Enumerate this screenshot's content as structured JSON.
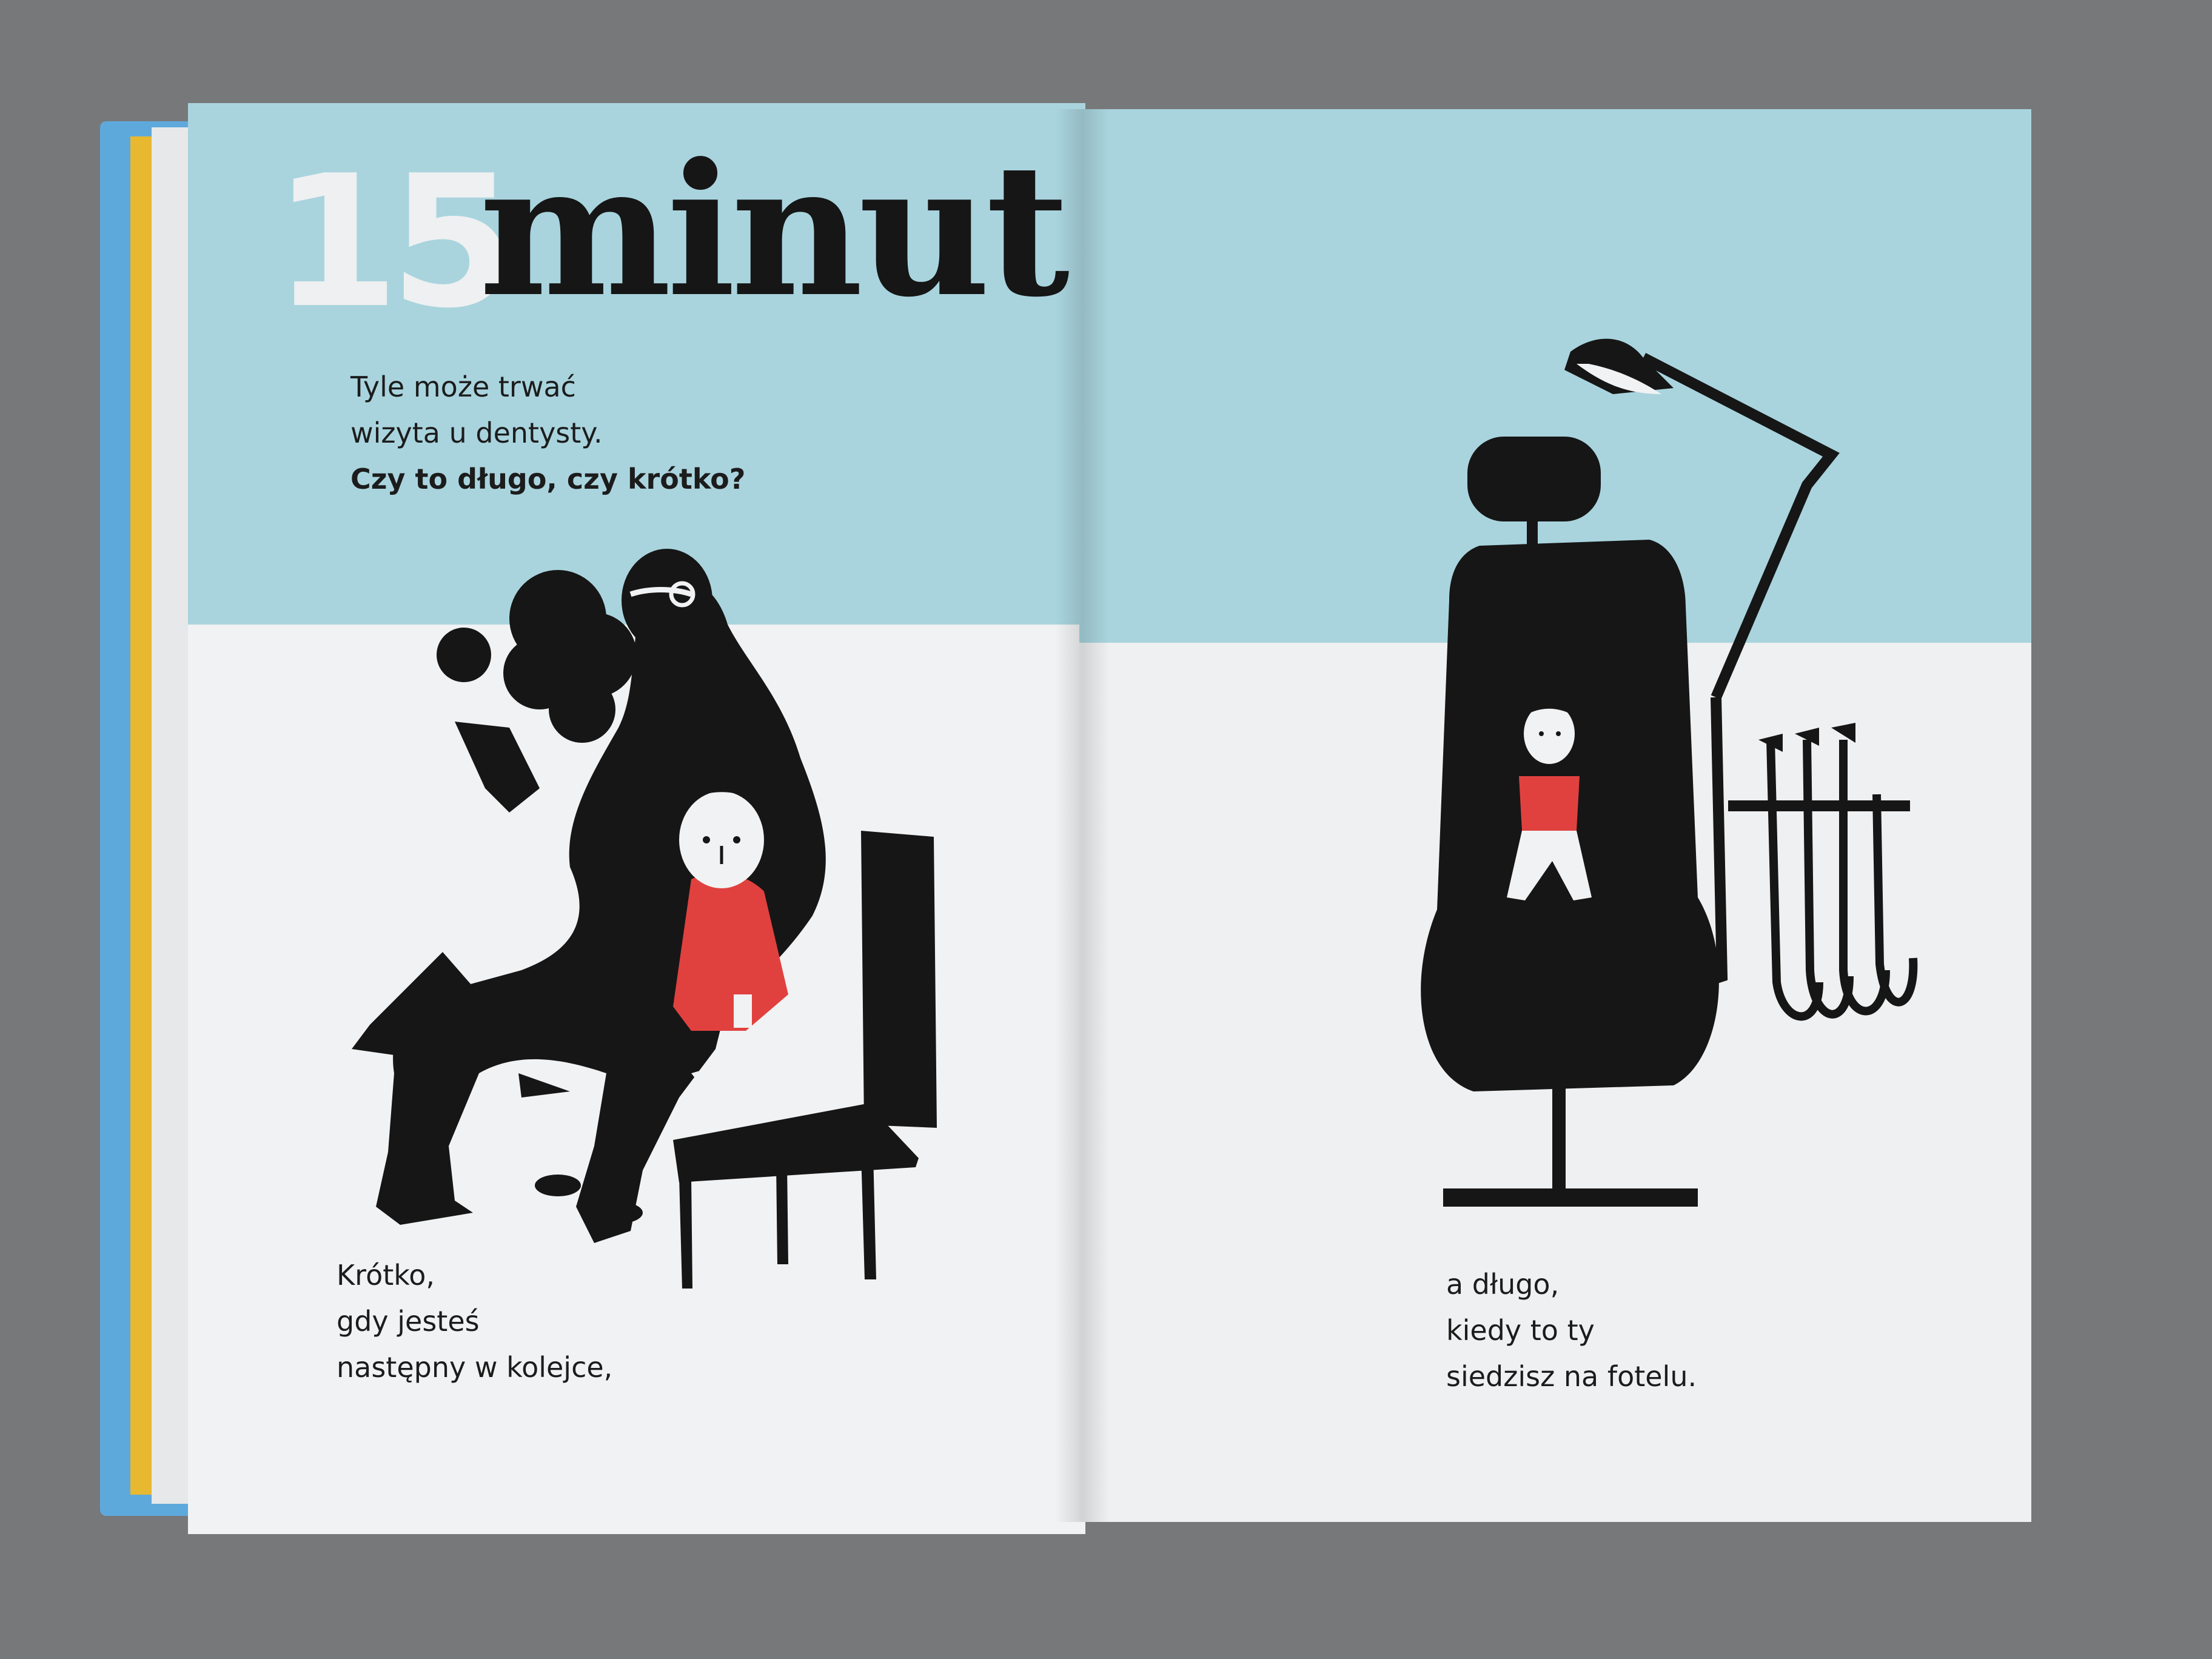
{
  "book": {
    "title_number": "15",
    "title_word": "minut",
    "intro_lines": [
      "Tyle może trwać",
      "wizyta u dentysty."
    ],
    "intro_question": "Czy to długo, czy krótko?",
    "left_caption": [
      "Krótko,",
      "gdy jesteś",
      "następny w kolejce,"
    ],
    "right_caption": [
      "a długo,",
      "kiedy to ty",
      "siedzisz na fotelu."
    ]
  },
  "colors": {
    "desk": "#77787a",
    "cover_blue": "#5ea9dc",
    "sky_blue": "#a9d4de",
    "paper": "#f1f2f3",
    "ink": "#161616",
    "shirt_red": "#e0413f",
    "spine_yellow": "#e8b830"
  }
}
